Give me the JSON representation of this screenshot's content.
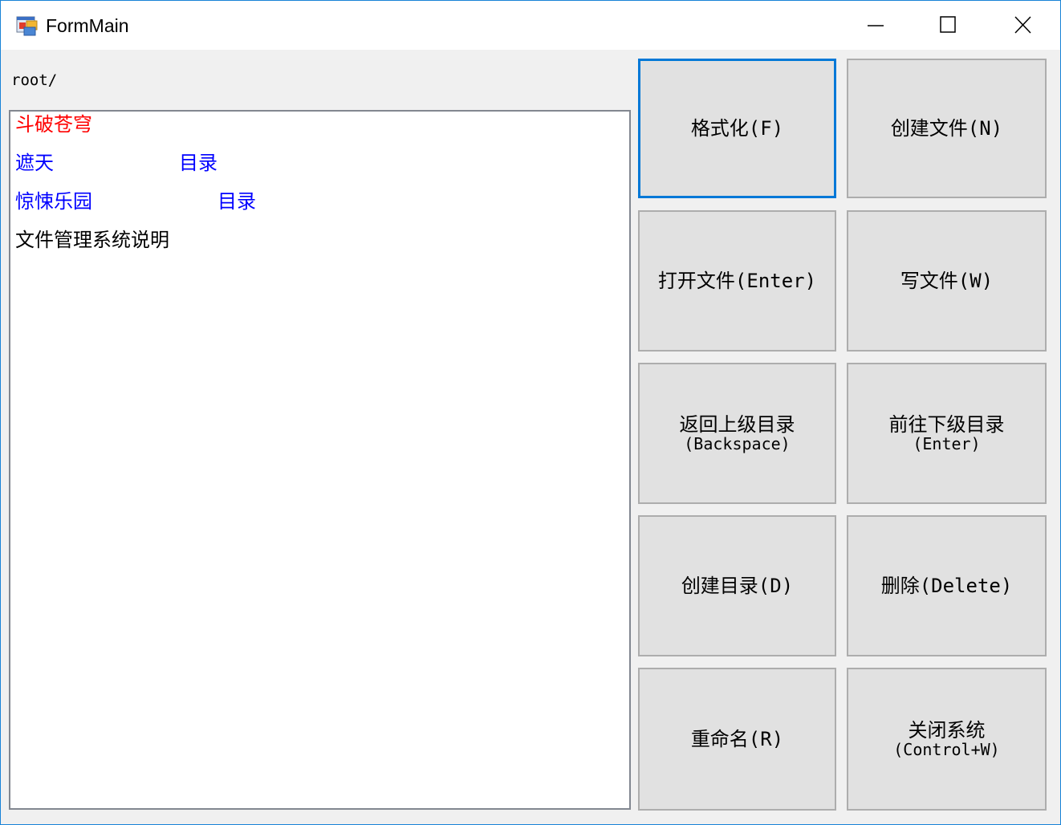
{
  "window": {
    "title": "FormMain",
    "controls": {
      "minimize": "minimize-icon",
      "maximize": "maximize-icon",
      "close": "close-icon"
    }
  },
  "path_label": "root/",
  "file_list": [
    {
      "name": "斗破苍穹",
      "type": "",
      "color": "#ff0000"
    },
    {
      "name": "遮天",
      "type": "目录",
      "color": "#0000ff"
    },
    {
      "name": "惊悚乐园",
      "type": "目录",
      "color": "#0000ff"
    },
    {
      "name": "文件管理系统说明",
      "type": "",
      "color": "#000000"
    }
  ],
  "buttons": {
    "format": {
      "label": "格式化(F)"
    },
    "create_file": {
      "label": "创建文件(N)"
    },
    "open_file": {
      "label": "打开文件(Enter)"
    },
    "write_file": {
      "label": "写文件(W)"
    },
    "go_up": {
      "line1": "返回上级目录",
      "line2": "(Backspace)"
    },
    "go_down": {
      "line1": "前往下级目录",
      "line2": "(Enter)"
    },
    "create_dir": {
      "label": "创建目录(D)"
    },
    "delete": {
      "label": "删除(Delete)"
    },
    "rename": {
      "label": "重命名(R)"
    },
    "close_system": {
      "line1": "关闭系统",
      "line2": "(Control+W)"
    }
  },
  "colors": {
    "accent": "#0078d7",
    "button_bg": "#e1e1e1",
    "form_bg": "#f0f0f0"
  }
}
